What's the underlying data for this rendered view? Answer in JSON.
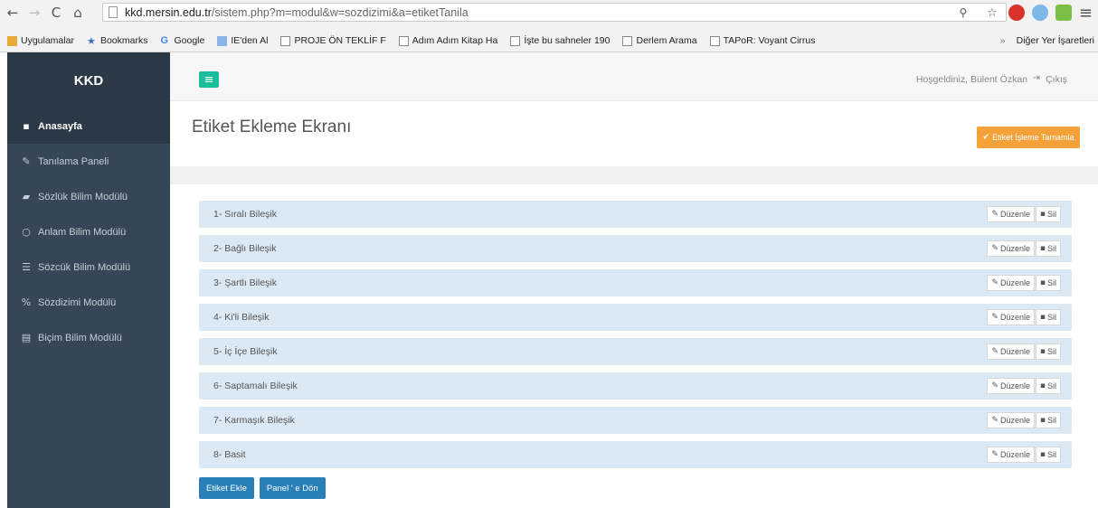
{
  "browser": {
    "url_host": "kkd.mersin.edu.tr",
    "url_path": "/sistem.php?m=modul&w=sozdizimi&a=etiketTanila",
    "bookmarks": [
      {
        "label": "Uygulamalar",
        "type": "apps"
      },
      {
        "label": "Bookmarks",
        "type": "star"
      },
      {
        "label": "Google",
        "type": "google"
      },
      {
        "label": "IE'den Al",
        "type": "folder"
      },
      {
        "label": "PROJE ÖN TEKLİF F",
        "type": "doc"
      },
      {
        "label": "Adım Adım Kitap Ha",
        "type": "doc"
      },
      {
        "label": "İşte bu sahneler 190",
        "type": "doc"
      },
      {
        "label": "Derlem Arama",
        "type": "doc"
      },
      {
        "label": "TAPoR: Voyant Cirrus",
        "type": "doc"
      }
    ],
    "other_bookmarks": "Diğer Yer İşaretleri"
  },
  "sidebar": {
    "brand": "KKD",
    "items": [
      {
        "label": "Anasayfa",
        "icon": "grid-icon"
      },
      {
        "label": "Tanılama Paneli",
        "icon": "pencil-icon"
      },
      {
        "label": "Sözlük Bilim Modülü",
        "icon": "book-icon"
      },
      {
        "label": "Anlam Bilim Modülü",
        "icon": "circle-icon"
      },
      {
        "label": "Sözcük Bilim Modülü",
        "icon": "list-icon"
      },
      {
        "label": "Sözdizimi Modülü",
        "icon": "percent-icon"
      },
      {
        "label": "Biçim Bilim Modülü",
        "icon": "document-icon"
      }
    ]
  },
  "header": {
    "welcome": "Hoşgeldiniz, Bülent Özkan",
    "logout": "Çıkış"
  },
  "page": {
    "title": "Etiket Ekleme Ekranı",
    "done_button": "Etiket İşleme Tamamla"
  },
  "tags": [
    {
      "label": "1- Sıralı Bileşik"
    },
    {
      "label": "2- Bağlı Bileşik"
    },
    {
      "label": "3- Şartlı Bileşik"
    },
    {
      "label": "4- Ki'li Bileşik"
    },
    {
      "label": "5- İç İçe Bileşik"
    },
    {
      "label": "6- Saptamalı Bileşik"
    },
    {
      "label": "7- Karmaşık Bileşik"
    },
    {
      "label": "8- Basit"
    }
  ],
  "row_actions": {
    "edit": "Düzenle",
    "delete": "Sil"
  },
  "bottom": {
    "add_tag": "Etiket Ekle",
    "back_panel": "Panel ' e Dön"
  },
  "colors": {
    "sidebar": "#364656",
    "accent_green": "#1abc9c",
    "orange": "#f5a13a",
    "blue_button": "#2980b9",
    "row_bg": "#dbe9f5"
  }
}
